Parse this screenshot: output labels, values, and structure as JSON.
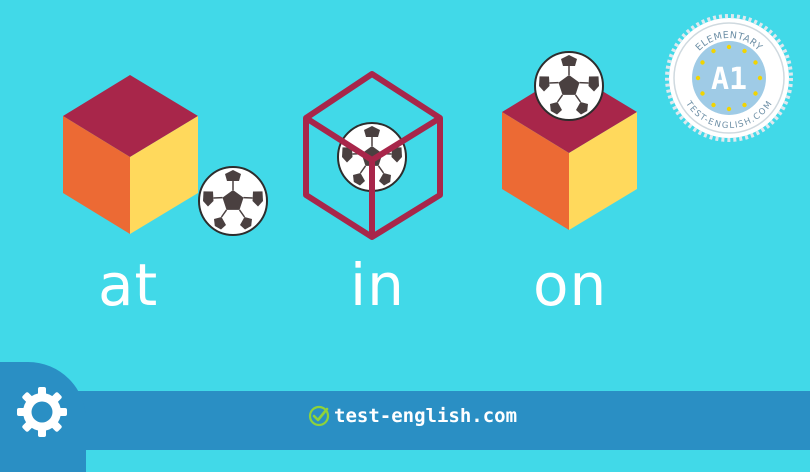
{
  "labels": {
    "at": "at",
    "in": "in",
    "on": "on"
  },
  "badge": {
    "top_text": "ELEMENTARY",
    "level": "A1",
    "bottom_text": "TEST-ENGLISH.COM"
  },
  "footer": {
    "brand": "test-english.com"
  },
  "icons": {
    "settings": "gear-icon",
    "check": "check-circle-icon",
    "ball": "soccer-ball-icon",
    "cube": "cube-icon"
  },
  "colors": {
    "background": "#41d9e8",
    "footer": "#2a8fc4",
    "cube_top": "#a8264a",
    "cube_left": "#ec6a34",
    "cube_right": "#ffd95c",
    "cube_outline": "#a8264a",
    "badge_blue": "#9fcbe6",
    "badge_star": "#f2d400",
    "check_green": "#8ed23a"
  }
}
